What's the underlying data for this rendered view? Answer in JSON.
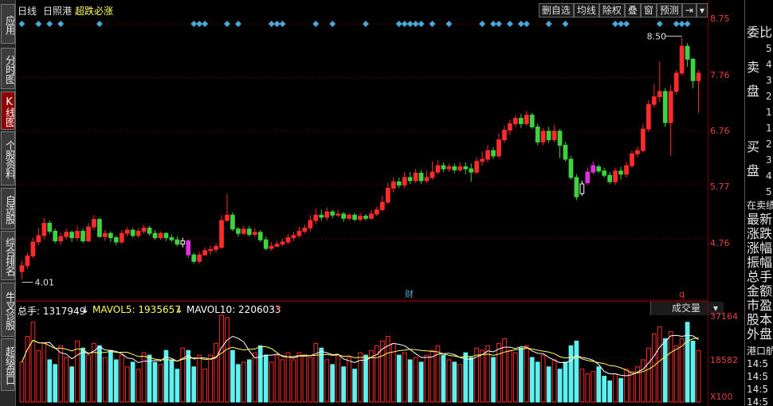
{
  "left_tabs": [
    {
      "label": "应用",
      "active": false,
      "icon": "play-icon"
    },
    {
      "label": "分时图",
      "active": false
    },
    {
      "label": "K线图",
      "active": true
    },
    {
      "label": "个股资料",
      "active": false
    },
    {
      "label": "自选股",
      "active": false
    },
    {
      "label": "综合排名",
      "active": false
    },
    {
      "label": "牛叉诊股",
      "active": false
    },
    {
      "label": "超级盘口",
      "active": false
    }
  ],
  "header": {
    "period": "日线",
    "stock_name": "日照港",
    "signal": "超跌必涨"
  },
  "toolbar": {
    "delete_watch": "删自选",
    "avg_line": "均线",
    "chip": "除权",
    "overlay": "叠",
    "window": "窗",
    "forecast": "预测"
  },
  "price_axis": {
    "labels": [
      "8.75",
      "7.76",
      "6.76",
      "5.77",
      "4.76"
    ]
  },
  "annotations": {
    "high_label": "8.50",
    "low_label": "4.01",
    "finance_marker": "财",
    "q_marker": "q"
  },
  "volume_header": {
    "total_label": "总手: 1317949",
    "mavol5_label": "MAVOL5: 1935657",
    "mavol10_label": "MAVOL10: 2206033",
    "indicator": "成交量"
  },
  "volume_axis": {
    "labels": [
      "37164",
      "18582"
    ],
    "unit": "X100"
  },
  "right_panel": {
    "committee": "委比",
    "sell": [
      "卖",
      "盘"
    ],
    "sell_nums": [
      "5",
      "4",
      "3",
      "2",
      "1"
    ],
    "buy": [
      "买",
      "盘"
    ],
    "buy_nums": [
      "1",
      "2",
      "3",
      "4",
      "5"
    ],
    "quote_title": "在卖绩",
    "fields": [
      "最新",
      "涨跌",
      "涨幅",
      "振幅",
      "总手",
      "金额",
      "市盈",
      "股本",
      "外盘"
    ],
    "trade_title": "港口航",
    "trade_times": [
      "14:5",
      "14:5",
      "14:5",
      "14:5"
    ]
  },
  "colors": {
    "up": "#ff2a2a",
    "down": "#3ed23e",
    "volume_down": "#5ff0f0",
    "pre": "#ffffff",
    "magenta": "#e030e0",
    "accent": "#c00000",
    "axis": "#7a0000",
    "grid": "#6b0000"
  },
  "chart_data": {
    "type": "candlestick",
    "title": "日照港 日线",
    "ylim": [
      4.01,
      8.75
    ],
    "high": 8.5,
    "low": 4.01,
    "candles": [
      [
        4.15,
        4.26,
        4.35,
        4.01
      ],
      [
        4.26,
        4.44,
        4.5,
        4.2
      ],
      [
        4.44,
        4.7,
        4.78,
        4.4
      ],
      [
        4.7,
        4.82,
        4.96,
        4.64
      ],
      [
        4.82,
        5.05,
        5.15,
        4.75
      ],
      [
        5.05,
        4.9,
        5.1,
        4.85
      ],
      [
        4.9,
        4.72,
        4.95,
        4.68
      ],
      [
        4.72,
        4.8,
        4.88,
        4.65
      ],
      [
        4.8,
        4.88,
        4.95,
        4.75
      ],
      [
        4.88,
        4.78,
        4.92,
        4.7
      ],
      [
        4.78,
        4.9,
        5.0,
        4.72
      ],
      [
        4.9,
        4.72,
        4.95,
        4.68
      ],
      [
        4.72,
        4.98,
        5.05,
        4.7
      ],
      [
        4.98,
        5.12,
        5.2,
        4.92
      ],
      [
        5.12,
        4.8,
        5.15,
        4.78
      ],
      [
        4.8,
        4.86,
        4.92,
        4.72
      ],
      [
        4.86,
        4.78,
        4.9,
        4.7
      ],
      [
        4.78,
        4.7,
        4.82,
        4.64
      ],
      [
        4.7,
        4.86,
        4.92,
        4.66
      ],
      [
        4.86,
        4.92,
        4.98,
        4.8
      ],
      [
        4.92,
        4.82,
        4.96,
        4.78
      ],
      [
        4.82,
        4.9,
        4.96,
        4.78
      ],
      [
        4.9,
        4.96,
        5.02,
        4.85
      ],
      [
        4.96,
        4.86,
        5.0,
        4.82
      ],
      [
        4.86,
        4.78,
        4.92,
        4.74
      ],
      [
        4.78,
        4.86,
        4.9,
        4.74
      ],
      [
        4.86,
        4.78,
        4.88,
        4.72
      ],
      [
        4.78,
        4.74,
        4.84,
        4.7
      ],
      [
        4.74,
        4.66,
        4.8,
        4.62
      ],
      [
        4.66,
        4.72,
        4.78,
        4.6
      ],
      [
        4.72,
        4.46,
        4.75,
        4.4
      ],
      [
        4.46,
        4.34,
        4.5,
        4.3
      ],
      [
        4.34,
        4.46,
        4.52,
        4.3
      ],
      [
        4.46,
        4.54,
        4.6,
        4.44
      ],
      [
        4.54,
        4.56,
        4.64,
        4.46
      ],
      [
        4.56,
        4.62,
        4.68,
        4.5
      ],
      [
        4.6,
        5.1,
        5.2,
        4.58
      ],
      [
        5.1,
        5.2,
        5.6,
        5.08
      ],
      [
        5.2,
        4.94,
        5.25,
        4.9
      ],
      [
        4.94,
        4.86,
        4.98,
        4.8
      ],
      [
        4.86,
        4.94,
        5.0,
        4.82
      ],
      [
        4.94,
        4.84,
        5.0,
        4.8
      ],
      [
        4.84,
        4.88,
        4.96,
        4.8
      ],
      [
        4.88,
        4.74,
        4.92,
        4.7
      ],
      [
        4.74,
        4.58,
        4.8,
        4.54
      ],
      [
        4.58,
        4.62,
        4.7,
        4.54
      ],
      [
        4.62,
        4.66,
        4.72,
        4.6
      ],
      [
        4.66,
        4.7,
        4.76,
        4.62
      ],
      [
        4.7,
        4.78,
        4.84,
        4.66
      ],
      [
        4.78,
        4.82,
        4.88,
        4.72
      ],
      [
        4.82,
        4.9,
        4.98,
        4.78
      ],
      [
        4.9,
        4.96,
        5.02,
        4.86
      ],
      [
        4.96,
        5.1,
        5.2,
        4.9
      ],
      [
        5.1,
        5.2,
        5.32,
        5.04
      ],
      [
        5.2,
        5.16,
        5.3,
        5.1
      ],
      [
        5.16,
        5.26,
        5.34,
        5.1
      ],
      [
        5.26,
        5.2,
        5.3,
        5.14
      ],
      [
        5.2,
        5.22,
        5.3,
        5.16
      ],
      [
        5.22,
        5.14,
        5.26,
        5.08
      ],
      [
        5.14,
        5.2,
        5.24,
        5.1
      ],
      [
        5.2,
        5.12,
        5.24,
        5.08
      ],
      [
        5.12,
        5.18,
        5.24,
        5.08
      ],
      [
        5.18,
        5.14,
        5.22,
        5.1
      ],
      [
        5.14,
        5.22,
        5.3,
        5.12
      ],
      [
        5.22,
        5.3,
        5.36,
        5.18
      ],
      [
        5.3,
        5.44,
        5.56,
        5.26
      ],
      [
        5.44,
        5.7,
        5.8,
        5.4
      ],
      [
        5.7,
        5.82,
        5.9,
        5.62
      ],
      [
        5.82,
        5.76,
        5.9,
        5.7
      ],
      [
        5.76,
        5.9,
        6.0,
        5.7
      ],
      [
        5.9,
        5.84,
        6.0,
        5.78
      ],
      [
        5.84,
        5.98,
        6.06,
        5.8
      ],
      [
        5.98,
        5.84,
        6.04,
        5.78
      ],
      [
        5.84,
        5.9,
        6.02,
        5.8
      ],
      [
        5.9,
        6.0,
        6.2,
        5.86
      ],
      [
        6.0,
        6.12,
        6.22,
        5.96
      ],
      [
        6.12,
        6.06,
        6.18,
        6.0
      ],
      [
        6.06,
        6.1,
        6.16,
        6.0
      ],
      [
        6.1,
        6.04,
        6.16,
        5.98
      ],
      [
        6.04,
        6.1,
        6.18,
        6.0
      ],
      [
        6.1,
        6.06,
        6.18,
        5.96
      ],
      [
        6.06,
        6.0,
        6.16,
        5.82
      ],
      [
        6.0,
        6.2,
        6.28,
        5.96
      ],
      [
        6.2,
        6.24,
        6.38,
        6.12
      ],
      [
        6.24,
        6.4,
        6.5,
        6.18
      ],
      [
        6.4,
        6.3,
        6.46,
        6.24
      ],
      [
        6.3,
        6.6,
        6.72,
        6.26
      ],
      [
        6.6,
        6.78,
        6.86,
        6.54
      ],
      [
        6.78,
        6.9,
        6.98,
        6.7
      ],
      [
        6.9,
        7.0,
        7.06,
        6.84
      ],
      [
        7.0,
        6.9,
        7.08,
        6.82
      ],
      [
        6.9,
        7.06,
        7.14,
        6.86
      ],
      [
        7.06,
        6.84,
        7.1,
        6.8
      ],
      [
        6.84,
        6.56,
        6.9,
        6.5
      ],
      [
        6.56,
        6.76,
        6.82,
        6.5
      ],
      [
        6.76,
        6.6,
        6.84,
        6.54
      ],
      [
        6.6,
        6.76,
        6.88,
        6.56
      ],
      [
        6.76,
        6.5,
        6.8,
        6.26
      ],
      [
        6.5,
        6.24,
        6.56,
        6.2
      ],
      [
        6.24,
        5.9,
        6.3,
        5.86
      ],
      [
        5.9,
        5.54,
        5.96,
        5.48
      ],
      [
        5.6,
        5.78,
        5.84,
        5.56
      ],
      [
        5.8,
        6.0,
        6.08,
        5.76
      ],
      [
        6.0,
        6.12,
        6.2,
        5.96
      ],
      [
        6.1,
        6.02,
        6.14,
        5.98
      ],
      [
        6.02,
        5.94,
        6.08,
        5.9
      ],
      [
        5.94,
        5.82,
        6.0,
        5.78
      ],
      [
        5.82,
        6.02,
        6.08,
        5.76
      ],
      [
        6.02,
        5.96,
        6.1,
        5.86
      ],
      [
        5.96,
        6.12,
        6.2,
        5.9
      ],
      [
        6.12,
        6.34,
        6.4,
        6.08
      ],
      [
        6.34,
        6.4,
        6.48,
        6.28
      ],
      [
        6.4,
        6.8,
        6.9,
        6.36
      ],
      [
        6.8,
        7.26,
        7.34,
        6.74
      ],
      [
        7.26,
        7.4,
        7.64,
        7.2
      ],
      [
        7.4,
        7.5,
        8.05,
        7.3
      ],
      [
        7.5,
        6.92,
        7.56,
        6.84
      ],
      [
        6.92,
        7.5,
        7.62,
        6.3
      ],
      [
        7.5,
        7.84,
        7.9,
        7.44
      ],
      [
        7.84,
        8.34,
        8.5,
        7.8
      ],
      [
        8.34,
        8.1,
        8.4,
        7.96
      ],
      [
        8.1,
        7.7,
        8.12,
        7.56
      ],
      [
        7.7,
        7.84,
        7.9,
        7.1
      ]
    ],
    "volume": [
      17,
      28,
      34,
      22,
      25,
      18,
      16,
      24,
      19,
      15,
      26,
      23,
      20,
      25,
      24,
      19,
      22,
      18,
      20,
      15,
      17,
      14,
      21,
      20,
      17,
      16,
      22,
      18,
      14,
      23,
      22,
      15,
      20,
      14,
      20,
      25,
      37,
      36,
      22,
      16,
      17,
      18,
      21,
      24,
      20,
      17,
      20,
      18,
      21,
      18,
      21,
      20,
      19,
      25,
      23,
      18,
      16,
      20,
      15,
      19,
      14,
      21,
      20,
      22,
      24,
      26,
      28,
      25,
      20,
      21,
      18,
      19,
      17,
      20,
      22,
      24,
      20,
      18,
      17,
      16,
      21,
      19,
      23,
      22,
      24,
      19,
      25,
      27,
      22,
      21,
      23,
      24,
      19,
      17,
      20,
      15,
      18,
      14,
      17,
      24,
      26,
      14,
      12,
      13,
      15,
      11,
      9,
      12,
      10,
      14,
      13,
      15,
      18,
      23,
      29,
      32,
      27,
      30,
      24,
      27,
      34,
      26,
      22
    ],
    "candle_types": {
      "white": [
        29,
        101
      ],
      "magenta": [
        30,
        102,
        103
      ]
    },
    "mavol5": [
      24,
      23,
      22,
      22,
      21,
      20
    ],
    "mavol10": [
      23,
      22,
      22,
      21,
      21,
      20
    ]
  }
}
